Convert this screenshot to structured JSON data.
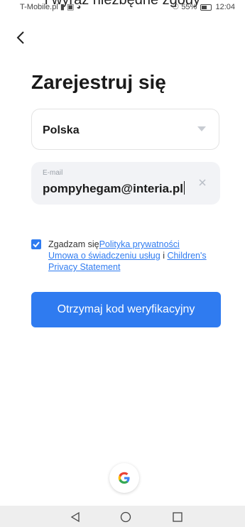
{
  "top_caption": "i wyraź niezbędne zgody",
  "status_bar": {
    "carrier": "T-Mobile.pl",
    "battery_percent": "55%",
    "time": "12:04"
  },
  "header": {
    "back_icon": "chevron-left-icon"
  },
  "page": {
    "title": "Zarejestruj się"
  },
  "country": {
    "value": "Polska",
    "icon": "triangle-down-icon"
  },
  "email": {
    "label": "E-mail",
    "value": "pompyhegam@interia.pl",
    "clear_icon": "close-icon"
  },
  "consent": {
    "checked": true,
    "prefix": "Zgadzam się",
    "privacy_link": "Polityka prywatności",
    "service_link": "Umowa o świadczeniu usług",
    "conjunction": " i ",
    "children_link": "Children's Privacy Statement"
  },
  "actions": {
    "submit_label": "Otrzymaj kod weryfikacyjny",
    "google_icon": "google-icon"
  },
  "colors": {
    "accent": "#2f7bf0",
    "title_text": "#1a1a1a",
    "input_bg": "#f2f3f6"
  },
  "navbar": {
    "back_icon": "nav-back-icon",
    "home_icon": "nav-home-icon",
    "recents_icon": "nav-recents-icon"
  }
}
